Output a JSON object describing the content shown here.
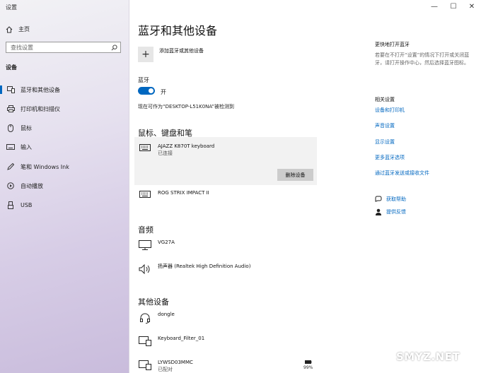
{
  "app": {
    "title": "设置",
    "controls": {
      "minimize": "—",
      "maximize": "☐",
      "close": "✕"
    }
  },
  "sidebar": {
    "home_label": "主页",
    "search_placeholder": "查找设置",
    "section_label": "设备",
    "items": [
      {
        "label": "蓝牙和其他设备",
        "icon": "bluetooth-devices-icon",
        "active": true
      },
      {
        "label": "打印机和扫描仪",
        "icon": "printer-icon"
      },
      {
        "label": "鼠标",
        "icon": "mouse-icon"
      },
      {
        "label": "输入",
        "icon": "keyboard-icon"
      },
      {
        "label": "笔和 Windows Ink",
        "icon": "pen-icon"
      },
      {
        "label": "自动播放",
        "icon": "autoplay-icon"
      },
      {
        "label": "USB",
        "icon": "usb-icon"
      }
    ]
  },
  "main": {
    "title": "蓝牙和其他设备",
    "add_device_label": "添加蓝牙或其他设备",
    "bluetooth_label": "蓝牙",
    "toggle_state_label": "开",
    "discoverable_text": "现在可作为“DESKTOP-L51K0NA”被检测到",
    "groups": {
      "input": {
        "title": "鼠标、键盘和笔",
        "devices": [
          {
            "name": "AJAZZ K870T keyboard",
            "status": "已连接",
            "icon": "keyboard-icon",
            "remove_label": "删除设备"
          },
          {
            "name": "ROG STRIX IMPACT II",
            "status": "",
            "icon": "keyboard-icon"
          }
        ]
      },
      "audio": {
        "title": "音频",
        "devices": [
          {
            "name": "VG27A",
            "status": "",
            "icon": "monitor-icon"
          },
          {
            "name": "扬声器 (Realtek High Definition Audio)",
            "status": "",
            "icon": "speaker-icon"
          }
        ]
      },
      "other": {
        "title": "其他设备",
        "devices": [
          {
            "name": "dongle",
            "status": "",
            "icon": "headset-icon"
          },
          {
            "name": "Keyboard_Filter_01",
            "status": "",
            "icon": "generic-device-icon"
          },
          {
            "name": "LYWSD03MMC",
            "status": "已配对",
            "icon": "generic-device-icon",
            "battery": "99%"
          }
        ]
      }
    }
  },
  "right": {
    "quick_title": "更快地打开蓝牙",
    "quick_desc": "若要在不打开“设置”的情况下打开或关闭蓝牙，请打开操作中心，然后选择蓝牙图标。",
    "related_title": "相关设置",
    "related_links": [
      "设备和打印机",
      "声音设置",
      "显示设置",
      "更多蓝牙选项",
      "通过蓝牙发送或接收文件"
    ],
    "help_label": "获取帮助",
    "feedback_label": "提供反馈"
  },
  "watermark": "SMYZ.NET",
  "colors": {
    "accent": "#0067c0"
  }
}
